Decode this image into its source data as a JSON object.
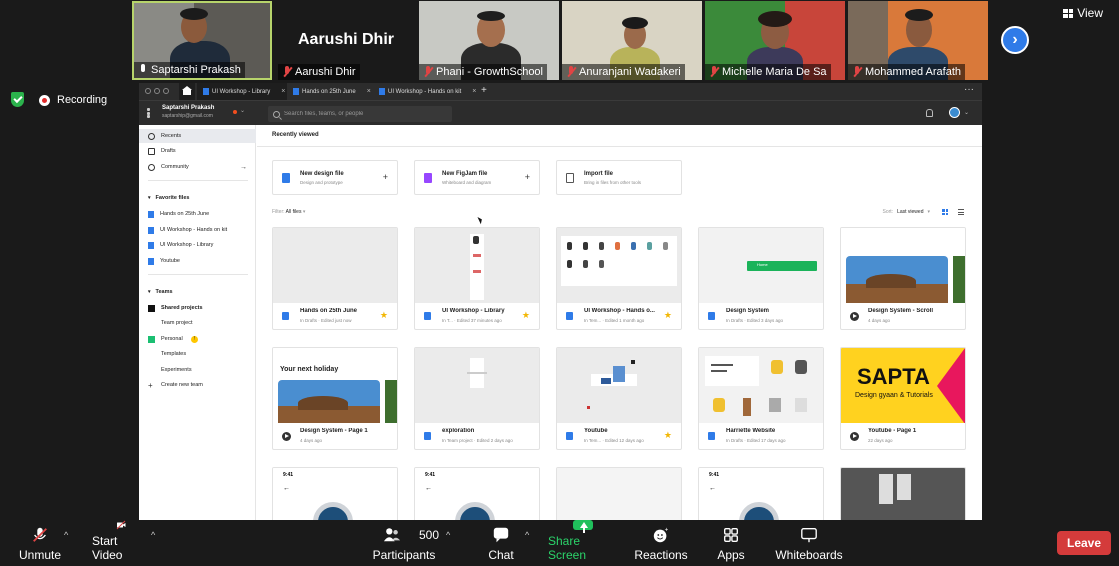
{
  "gallery": {
    "participants": [
      {
        "name": "Saptarshi Prakash",
        "muted": false
      },
      {
        "name": "Aarushi Dhir",
        "muted": true
      },
      {
        "name": "Phani - GrowthSchool",
        "muted": true
      },
      {
        "name": "Anuranjani Wadakeri",
        "muted": true
      },
      {
        "name": "Michelle Maria De Sa",
        "muted": true
      },
      {
        "name": "Mohammed Arafath",
        "muted": true
      }
    ],
    "big_name": "Aarushi Dhir",
    "view_label": "View"
  },
  "recording": {
    "label": "Recording"
  },
  "figma": {
    "tabs": [
      "UI Workshop - Library",
      "Hands on 25th June",
      "UI Workshop - Hands on kit"
    ],
    "user": {
      "name": "Saptarshi Prakash",
      "email": "saptarship@gmail.com"
    },
    "search_placeholder": "Search files, teams, or people",
    "sidebar": {
      "nav": [
        {
          "label": "Recents",
          "icon": "clock-icon"
        },
        {
          "label": "Drafts",
          "icon": "drafts-icon"
        },
        {
          "label": "Community",
          "icon": "globe-icon"
        }
      ],
      "favorites_heading": "Favorite files",
      "favorites": [
        "Hands on 25th June",
        "UI Workshop - Hands on kit",
        "UI Workshop - Library",
        "Youtube"
      ],
      "teams_heading": "Teams",
      "teams": [
        {
          "label": "Shared projects",
          "icon": "team-black"
        },
        {
          "label": "Team project",
          "icon": "none"
        },
        {
          "label": "Personal",
          "icon": "team-green"
        },
        {
          "label": "Templates",
          "icon": "none"
        },
        {
          "label": "Experiments",
          "icon": "none"
        },
        {
          "label": "Create new team",
          "icon": "plus"
        }
      ],
      "personal_badge": "!"
    },
    "main": {
      "title": "Recently viewed",
      "new_cards": [
        {
          "title": "New design file",
          "subtitle": "Design and prototype",
          "color": "#2f7be8"
        },
        {
          "title": "New FigJam file",
          "subtitle": "Whiteboard and diagram",
          "color": "#9747ff"
        },
        {
          "title": "Import file",
          "subtitle": "Bring in files from other tools",
          "color": "#ffffff"
        }
      ],
      "filter_label": "Filter:",
      "filter_value": "All files",
      "sort_label": "Sort:",
      "sort_value": "Last viewed",
      "files": [
        {
          "name": "Hands on 25th June",
          "sub": "In Drafts · Edited just now",
          "starred": true,
          "type": "design"
        },
        {
          "name": "UI Workshop - Library",
          "sub": "In T... · Edited 37 minutes ago",
          "starred": true,
          "type": "design"
        },
        {
          "name": "UI Workshop - Hands o...",
          "sub": "In Tem... · Edited 1 month ago",
          "starred": true,
          "type": "design"
        },
        {
          "name": "Design System",
          "sub": "In Drafts · Edited 3 days ago",
          "starred": false,
          "type": "design"
        },
        {
          "name": "Design System - Scroll",
          "sub": "4 days ago",
          "starred": false,
          "type": "prototype"
        },
        {
          "name": "Design System - Page 1",
          "sub": "4 days ago",
          "starred": false,
          "type": "prototype"
        },
        {
          "name": "exploration",
          "sub": "In Team project · Edited 2 days ago",
          "starred": false,
          "type": "design"
        },
        {
          "name": "Youtube",
          "sub": "In Tem... · Edited 12 days ago",
          "starred": true,
          "type": "design"
        },
        {
          "name": "Harriette Website",
          "sub": "In Drafts · Edited 17 days ago",
          "starred": false,
          "type": "design"
        },
        {
          "name": "Youtube - Page 1",
          "sub": "22 days ago",
          "starred": false,
          "type": "prototype"
        }
      ],
      "thumb_texts": {
        "holiday": "Your next holiday",
        "home_button": "Home",
        "sapta": "SAPTA",
        "sapta_sub": "Design gyaan & Tutorials",
        "time": "9:41"
      }
    }
  },
  "controls": {
    "unmute": "Unmute",
    "start_video": "Start Video",
    "participants": "Participants",
    "participants_count": "500",
    "chat": "Chat",
    "share_screen": "Share Screen",
    "reactions": "Reactions",
    "apps": "Apps",
    "whiteboards": "Whiteboards",
    "leave": "Leave"
  }
}
